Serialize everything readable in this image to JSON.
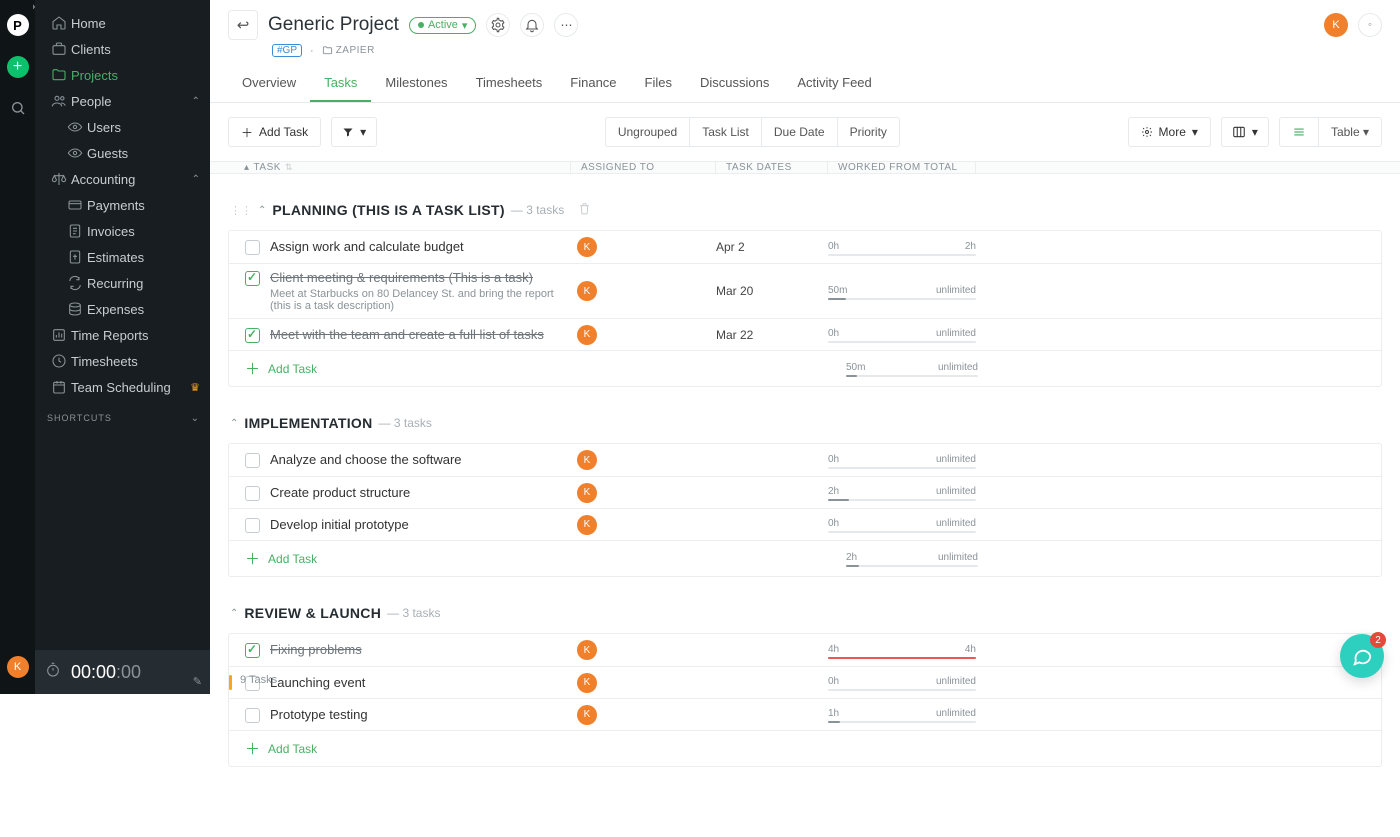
{
  "rail": {
    "logo_letter": "P",
    "avatar_letter": "K"
  },
  "sidebar": {
    "items": [
      {
        "label": "Home"
      },
      {
        "label": "Clients"
      },
      {
        "label": "Projects"
      },
      {
        "label": "People"
      },
      {
        "label": "Users"
      },
      {
        "label": "Guests"
      },
      {
        "label": "Accounting"
      },
      {
        "label": "Payments"
      },
      {
        "label": "Invoices"
      },
      {
        "label": "Estimates"
      },
      {
        "label": "Recurring"
      },
      {
        "label": "Expenses"
      },
      {
        "label": "Time Reports"
      },
      {
        "label": "Timesheets"
      },
      {
        "label": "Team Scheduling"
      }
    ],
    "shortcuts_label": "SHORTCUTS",
    "timer": "00:00",
    "timer_frac": ":00"
  },
  "header": {
    "title": "Generic Project",
    "status": "Active",
    "badge": "#GP",
    "folder": "ZAPIER",
    "avatar_letter": "K",
    "second_avatar_symbol": "◦"
  },
  "tabs": [
    {
      "label": "Overview"
    },
    {
      "label": "Tasks"
    },
    {
      "label": "Milestones"
    },
    {
      "label": "Timesheets"
    },
    {
      "label": "Finance"
    },
    {
      "label": "Files"
    },
    {
      "label": "Discussions"
    },
    {
      "label": "Activity Feed"
    }
  ],
  "toolbar": {
    "add_task": "Add Task",
    "grouping": [
      "Ungrouped",
      "Task List",
      "Due Date",
      "Priority"
    ],
    "more": "More",
    "view_labels": {
      "table": "Table"
    }
  },
  "columns": {
    "task": "TASK",
    "assigned": "ASSIGNED TO",
    "dates": "TASK DATES",
    "worked": "WORKED FROM TOTAL"
  },
  "groups": [
    {
      "title": "PLANNING (THIS IS A TASK LIST)",
      "count_label": "3 tasks",
      "show_delete": true,
      "rows": [
        {
          "done": false,
          "title": "Assign work and calculate budget",
          "assignee": "K",
          "date": "Apr 2",
          "work_left": "0h",
          "work_right": "2h",
          "fill": 0,
          "fill_kind": "safe"
        },
        {
          "done": true,
          "title": "Client meeting & requirements (This is a task)",
          "desc": "Meet at Starbucks on 80 Delancey St. and bring the report (this is a task description)",
          "assignee": "K",
          "date": "Mar 20",
          "work_left": "50m",
          "work_right": "unlimited",
          "fill": 12,
          "fill_kind": "safe"
        },
        {
          "done": true,
          "title": "Meet with the team and create a full list of tasks",
          "assignee": "K",
          "date": "Mar 22",
          "work_left": "0h",
          "work_right": "unlimited",
          "fill": 0,
          "fill_kind": "safe"
        }
      ],
      "add_label": "Add Task",
      "totals": {
        "left": "50m",
        "right": "unlimited",
        "fill": 8
      }
    },
    {
      "title": "IMPLEMENTATION",
      "count_label": "3 tasks",
      "show_delete": false,
      "rows": [
        {
          "done": false,
          "title": "Analyze and choose the software",
          "assignee": "K",
          "date": "",
          "work_left": "0h",
          "work_right": "unlimited",
          "fill": 0,
          "fill_kind": "safe"
        },
        {
          "done": false,
          "title": "Create product structure",
          "assignee": "K",
          "date": "",
          "work_left": "2h",
          "work_right": "unlimited",
          "fill": 14,
          "fill_kind": "safe"
        },
        {
          "done": false,
          "title": "Develop initial prototype",
          "assignee": "K",
          "date": "",
          "work_left": "0h",
          "work_right": "unlimited",
          "fill": 0,
          "fill_kind": "safe"
        }
      ],
      "add_label": "Add Task",
      "totals": {
        "left": "2h",
        "right": "unlimited",
        "fill": 10
      }
    },
    {
      "title": "REVIEW & LAUNCH",
      "count_label": "3 tasks",
      "show_delete": false,
      "rows": [
        {
          "done": true,
          "title": "Fixing problems",
          "assignee": "K",
          "date": "",
          "work_left": "4h",
          "work_right": "4h",
          "fill": 100,
          "fill_kind": "over"
        },
        {
          "done": false,
          "title": "Launching event",
          "assignee": "K",
          "date": "",
          "work_left": "0h",
          "work_right": "unlimited",
          "fill": 0,
          "fill_kind": "safe",
          "priority": "high"
        },
        {
          "done": false,
          "title": "Prototype testing",
          "assignee": "K",
          "date": "",
          "work_left": "1h",
          "work_right": "unlimited",
          "fill": 8,
          "fill_kind": "safe"
        }
      ],
      "add_label": "Add Task"
    }
  ],
  "footer": {
    "task_count": "9 Tasks"
  },
  "chat": {
    "badge": "2"
  }
}
